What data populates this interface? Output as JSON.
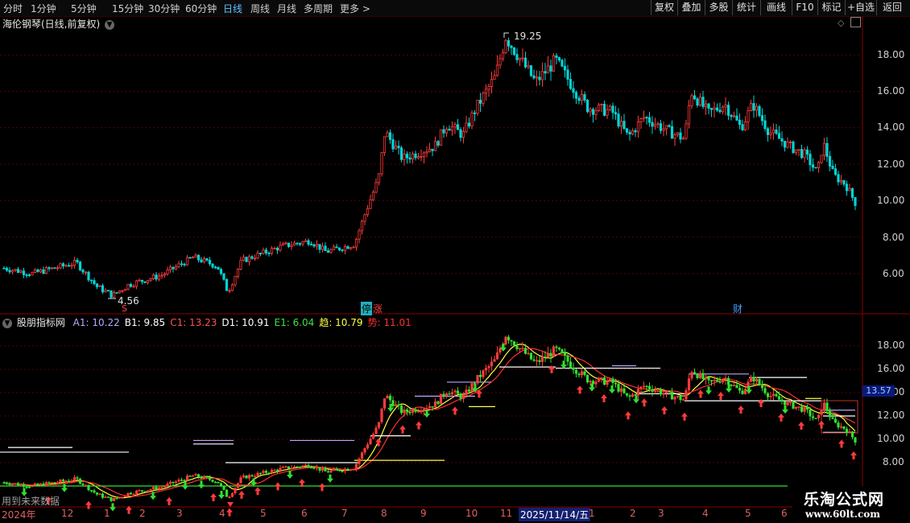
{
  "toolbar": {
    "timeframes": [
      "分时",
      "1分钟",
      "5分钟",
      "15分钟",
      "30分钟",
      "60分钟",
      "日线",
      "周线",
      "月线",
      "多周期",
      "更多 >"
    ],
    "active": "日线",
    "buttons": [
      "复权",
      "叠加",
      "多股",
      "统计",
      "画线",
      "F10",
      "标记",
      "+自选",
      "返回"
    ]
  },
  "main_pane": {
    "title": "海伦钢琴(日线,前复权)",
    "high_label": "19.25",
    "low_label": "4.56",
    "y_ticks": [
      "18.00",
      "16.00",
      "14.00",
      "12.00",
      "10.00",
      "8.00",
      "6.00"
    ],
    "markers": [
      "S",
      "停",
      "涨",
      "财"
    ]
  },
  "indicator": {
    "name": "股朋指标网",
    "values": [
      {
        "label": "A1: 10.22",
        "color": "#b9a8ff"
      },
      {
        "label": "B1: 9.85",
        "color": "#ffffff"
      },
      {
        "label": "C1: 13.23",
        "color": "#ff5050"
      },
      {
        "label": "D1: 10.91",
        "color": "#ffffff"
      },
      {
        "label": "E1: 6.04",
        "color": "#40e040"
      },
      {
        "label": "趋: 10.79",
        "color": "#ffff40"
      },
      {
        "label": "势: 11.01",
        "color": "#ff3030"
      }
    ],
    "y_ticks": [
      "18.00",
      "16.00",
      "14.00",
      "12.00",
      "10.00",
      "8.00"
    ],
    "price_tag": "13.57",
    "note": "用到未来数据"
  },
  "x_axis": {
    "labels": [
      "2024年",
      "12",
      "1",
      "2",
      "3",
      "4",
      "5",
      "6",
      "7",
      "8",
      "9",
      "10",
      "11",
      "2025/11/14/五",
      "1",
      "2",
      "3",
      "4",
      "5",
      "6"
    ]
  },
  "watermark": {
    "line1": "乐淘公式网",
    "line2": "www.60lt.com"
  },
  "colors": {
    "up": "#ff3b3b",
    "down": "#00d4d4",
    "grid": "#5a0000",
    "border": "#8a0000"
  }
}
